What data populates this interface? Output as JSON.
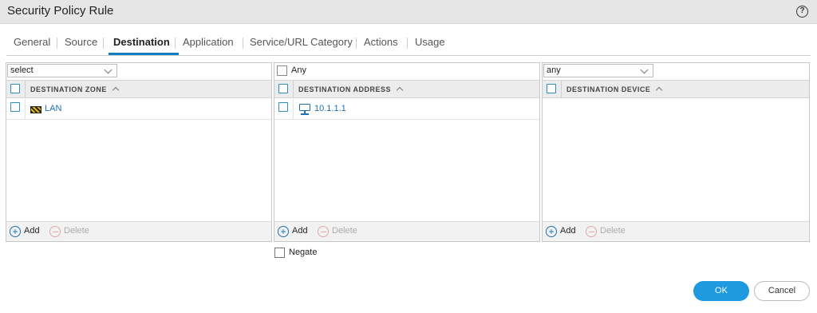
{
  "dialog": {
    "title": "Security Policy Rule",
    "help_icon": "?"
  },
  "tabs": [
    {
      "label": "General"
    },
    {
      "label": "Source"
    },
    {
      "label": "Destination",
      "active": true
    },
    {
      "label": "Application"
    },
    {
      "label": "Service/URL Category"
    },
    {
      "label": "Actions"
    },
    {
      "label": "Usage"
    }
  ],
  "zone_panel": {
    "select_value": "select",
    "header": "DESTINATION ZONE",
    "rows": [
      {
        "label": "LAN",
        "icon": "zone-icon"
      }
    ],
    "add_label": "Add",
    "delete_label": "Delete"
  },
  "address_panel": {
    "any_label": "Any",
    "header": "DESTINATION ADDRESS",
    "rows": [
      {
        "label": "10.1.1.1",
        "icon": "address-host-icon"
      }
    ],
    "add_label": "Add",
    "delete_label": "Delete"
  },
  "device_panel": {
    "select_value": "any",
    "header": "DESTINATION DEVICE",
    "rows": [],
    "add_label": "Add",
    "delete_label": "Delete"
  },
  "negate_label": "Negate",
  "buttons": {
    "ok": "OK",
    "cancel": "Cancel"
  },
  "colors": {
    "accent": "#1f9ae0",
    "link": "#1a6fb5",
    "tab_active_underline": "#0d7fc2"
  }
}
